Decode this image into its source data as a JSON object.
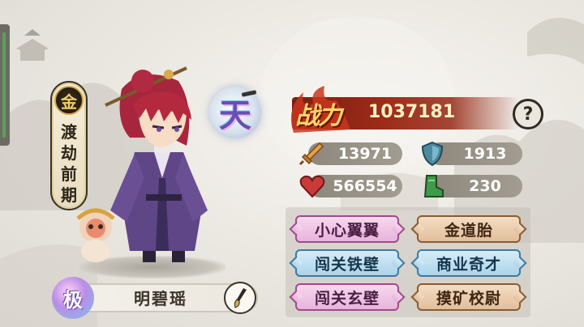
{
  "realm": {
    "badge": "金",
    "lines": [
      "渡",
      "劫",
      "前",
      "期"
    ]
  },
  "grade": {
    "label": "天"
  },
  "character": {
    "tier": "极",
    "name": "明碧瑶"
  },
  "power": {
    "label": "战力",
    "value": "1037181",
    "help": "?"
  },
  "stats": {
    "attack": {
      "icon": "sword-icon",
      "value": "13971"
    },
    "defense": {
      "icon": "shield-icon",
      "value": "1913"
    },
    "hp": {
      "icon": "heart-icon",
      "value": "566554"
    },
    "speed": {
      "icon": "boot-icon",
      "value": "230"
    }
  },
  "traits": [
    {
      "label": "小心翼翼",
      "style": "pink"
    },
    {
      "label": "金道胎",
      "style": "brown"
    },
    {
      "label": "闯关铁壁",
      "style": "blue"
    },
    {
      "label": "商业奇才",
      "style": "blue"
    },
    {
      "label": "闯关玄壁",
      "style": "pink"
    },
    {
      "label": "摸矿校尉",
      "style": "brown"
    }
  ],
  "colors": {
    "power_bar": "#9e2a18",
    "power_text": "#fff2c4",
    "stat_pill": "#9a9489"
  }
}
